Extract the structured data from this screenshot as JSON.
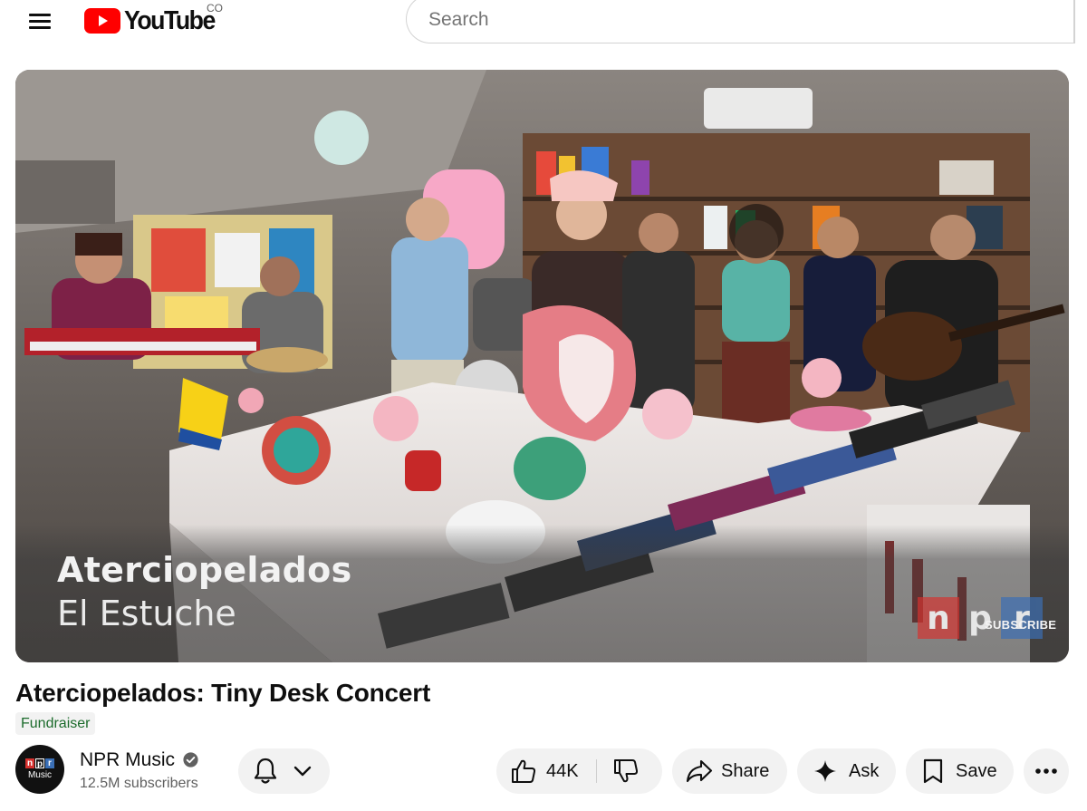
{
  "header": {
    "logo_text": "YouTube",
    "region_code": "CO",
    "search_placeholder": "Search"
  },
  "player": {
    "overlay_artist": "Aterciopelados",
    "overlay_song": "El Estuche",
    "watermark": {
      "letters": [
        "n",
        "p",
        "r"
      ],
      "colors": [
        "#d6322f",
        "#222222",
        "#3a6fb6"
      ],
      "subscribe_label": "SUBSCRIBE"
    }
  },
  "video": {
    "title": "Aterciopelados: Tiny Desk Concert",
    "badge": "Fundraiser"
  },
  "channel": {
    "name": "NPR Music",
    "subscribers": "12.5M subscribers",
    "avatar_letters": [
      "n",
      "p",
      "r"
    ],
    "avatar_label": "Music",
    "verified_icon": "verified-check-icon"
  },
  "actions": {
    "like_count": "44K",
    "share_label": "Share",
    "ask_label": "Ask",
    "save_label": "Save"
  },
  "colors": {
    "brand_red": "#ff0000",
    "badge_green": "#065f1f",
    "pill_bg": "#f2f2f2",
    "npr_red": "#d6322f",
    "npr_blue": "#3a6fb6"
  }
}
